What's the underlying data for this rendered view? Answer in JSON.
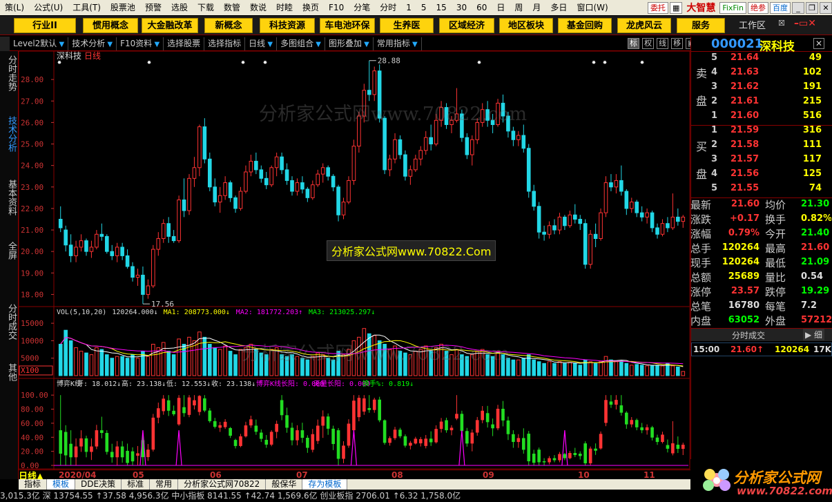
{
  "menu": {
    "items": [
      "策(L)",
      "公式(U)",
      "工具(T)",
      "股票池",
      "预警",
      "选股",
      "下载",
      "数管",
      "数说",
      "时睦",
      "换页",
      "F10",
      "分笔",
      "分时",
      "1",
      "5",
      "15",
      "30",
      "60",
      "日",
      "周",
      "月",
      "多日",
      "窗口(W)"
    ],
    "entrust": "委托",
    "brand": "大智慧",
    "fixfin": "FixFin",
    "judge": "绝参",
    "baidu": "百度"
  },
  "sectors": [
    "行业II",
    "惯用概念",
    "大金融改革",
    "新概念",
    "科技资源",
    "车电池环保",
    "生养医",
    "区域经济",
    "地区板块",
    "基金回购",
    "龙虎风云",
    "服务"
  ],
  "workzone": "工作区",
  "toolbar": {
    "items": [
      "Level2默认",
      "技术分析",
      "F10资料",
      "选择股票",
      "选择指标",
      "日线",
      "多图组合",
      "图形叠加",
      "常用指标"
    ],
    "right": [
      "标",
      "权",
      "线",
      "移"
    ]
  },
  "left_tabs": [
    "分时走势",
    "技术分析",
    "基本资料",
    "全屏",
    "分时成交",
    "其他"
  ],
  "stock": {
    "code": "000021",
    "name": "深科技",
    "chart_title": "深科技",
    "chart_period": "日线"
  },
  "order_book": {
    "sell_label": [
      "卖",
      "盘"
    ],
    "buy_label": [
      "买",
      "盘"
    ],
    "sell": [
      {
        "level": "5",
        "price": "21.64",
        "vol": "49"
      },
      {
        "level": "4",
        "price": "21.63",
        "vol": "102"
      },
      {
        "level": "3",
        "price": "21.62",
        "vol": "191"
      },
      {
        "level": "2",
        "price": "21.61",
        "vol": "215"
      },
      {
        "level": "1",
        "price": "21.60",
        "vol": "516"
      }
    ],
    "buy": [
      {
        "level": "1",
        "price": "21.59",
        "vol": "316"
      },
      {
        "level": "2",
        "price": "21.58",
        "vol": "111"
      },
      {
        "level": "3",
        "price": "21.57",
        "vol": "117"
      },
      {
        "level": "4",
        "price": "21.56",
        "vol": "125"
      },
      {
        "level": "5",
        "price": "21.55",
        "vol": "74"
      }
    ]
  },
  "stats": [
    {
      "k1": "最新",
      "v1": "21.60",
      "c1": "red",
      "k2": "均价",
      "v2": "21.30",
      "c2": "grn"
    },
    {
      "k1": "涨跌",
      "v1": "+0.17",
      "c1": "red",
      "k2": "换手",
      "v2": "0.82%",
      "c2": "yel"
    },
    {
      "k1": "涨幅",
      "v1": "0.79%",
      "c1": "red",
      "k2": "今开",
      "v2": "21.40",
      "c2": "grn"
    },
    {
      "k1": "总手",
      "v1": "120264",
      "c1": "yel",
      "k2": "最高",
      "v2": "21.60",
      "c2": "red"
    },
    {
      "k1": "现手",
      "v1": "120264",
      "c1": "yel",
      "k2": "最低",
      "v2": "21.09",
      "c2": "grn"
    },
    {
      "k1": "总额",
      "v1": "25689",
      "c1": "yel",
      "k2": "量比",
      "v2": "0.54",
      "c2": "wht"
    },
    {
      "k1": "涨停",
      "v1": "23.57",
      "c1": "red",
      "k2": "跌停",
      "v2": "19.29",
      "c2": "grn"
    },
    {
      "k1": "总笔",
      "v1": "16780",
      "c1": "wht",
      "k2": "每笔",
      "v2": "7.2",
      "c2": "wht"
    },
    {
      "k1": "内盘",
      "v1": "63052",
      "c1": "grn",
      "k2": "外盘",
      "v2": "57212",
      "c2": "red"
    }
  ],
  "fs": {
    "label": "分时成交",
    "more": "细",
    "time": "15:00",
    "price": "21.60↑",
    "vol": "120264",
    "extra": "17K"
  },
  "vol_legend": {
    "name": "VOL(5,10,20)",
    "vol": "120264.000↓",
    "ma1": "MA1: 208773.000↓",
    "ma2": "MA2: 181772.203↑",
    "ma3": "MA3: 213025.297↓"
  },
  "ind_legend": {
    "name": "博弈K线",
    "open": "开: 18.012↓",
    "high": "高: 23.138↓",
    "low": "低: 12.553↓",
    "close": "收: 23.138↓",
    "long": "博弈K线长阳: 0.000",
    "noyang": "无量长阳: 0.000",
    "turnover": "换手%: 0.819↓"
  },
  "annotations": {
    "high": "28.88",
    "low": "17.56",
    "vol_mult": "X100"
  },
  "bottom_axis": {
    "labels": [
      "2020/04",
      "05",
      "06",
      "07",
      "08",
      "09",
      "10",
      "11"
    ],
    "period": "日线"
  },
  "bottom_tabs": [
    "指标",
    "模板",
    "DDE决策",
    "标准",
    "常用",
    "分析家公式网70822",
    "般保华",
    "存为模板"
  ],
  "ticker": "3,015.3亿  深 13754.55  ↑37.58  4,956.3亿  中小指板 8141.55  ↑42.74  1,569.6亿  创业板指 2706.01  ↑6.32  1,758.0亿",
  "watermarks": [
    "分析家公式网www.70822.com",
    "分析家公式网www.70822.com"
  ],
  "wm_box": "分析家公式网www.70822.Com",
  "footer": {
    "logo": "分析家公式网",
    "url": "www.70822.com"
  },
  "chart_data": [
    {
      "type": "candlestick",
      "title": "深科技 日线",
      "ylim": [
        17.5,
        29
      ],
      "yticks": [
        "18.00",
        "19.00",
        "20.00",
        "21.00",
        "22.00",
        "23.00",
        "24.00",
        "25.00",
        "26.00",
        "27.00",
        "28.00"
      ],
      "ohlc": [
        [
          21.5,
          22.1,
          20.9,
          21.1
        ],
        [
          21.0,
          21.2,
          20.0,
          20.3
        ],
        [
          20.3,
          20.8,
          19.5,
          19.8
        ],
        [
          19.8,
          20.5,
          19.5,
          20.2
        ],
        [
          20.2,
          20.8,
          20.0,
          20.5
        ],
        [
          20.5,
          20.6,
          19.8,
          20.0
        ],
        [
          20.0,
          20.5,
          19.7,
          20.2
        ],
        [
          20.2,
          21.0,
          20.1,
          20.8
        ],
        [
          20.8,
          21.3,
          20.5,
          20.7
        ],
        [
          20.7,
          20.8,
          19.9,
          20.0
        ],
        [
          20.0,
          20.3,
          19.6,
          19.8
        ],
        [
          19.8,
          20.4,
          19.5,
          20.2
        ],
        [
          20.2,
          20.4,
          19.6,
          19.8
        ],
        [
          19.8,
          20.1,
          19.2,
          19.3
        ],
        [
          19.3,
          19.5,
          18.6,
          18.8
        ],
        [
          18.8,
          19.2,
          18.4,
          18.9
        ],
        [
          18.9,
          19.3,
          17.56,
          18.0
        ],
        [
          18.0,
          18.7,
          17.8,
          18.4
        ],
        [
          18.4,
          20.3,
          18.3,
          20.1
        ],
        [
          20.1,
          20.9,
          19.8,
          20.6
        ],
        [
          20.6,
          21.5,
          20.4,
          21.3
        ],
        [
          21.3,
          21.6,
          20.4,
          20.7
        ],
        [
          20.7,
          21.0,
          20.4,
          20.5
        ],
        [
          20.5,
          22.6,
          20.4,
          22.4
        ],
        [
          22.4,
          23.4,
          21.6,
          21.9
        ],
        [
          21.9,
          23.6,
          21.7,
          23.4
        ],
        [
          23.4,
          24.4,
          23.0,
          23.9
        ],
        [
          23.9,
          25.9,
          23.5,
          25.8
        ],
        [
          25.8,
          26.2,
          24.1,
          24.3
        ],
        [
          24.3,
          24.6,
          22.8,
          23.0
        ],
        [
          23.0,
          23.4,
          22.1,
          22.3
        ],
        [
          22.3,
          23.0,
          21.8,
          22.6
        ],
        [
          22.6,
          23.5,
          22.4,
          23.2
        ],
        [
          23.2,
          23.3,
          22.3,
          22.5
        ],
        [
          22.5,
          22.6,
          21.8,
          22.0
        ],
        [
          22.0,
          23.0,
          21.9,
          22.8
        ],
        [
          22.8,
          24.0,
          22.7,
          23.7
        ],
        [
          23.7,
          24.5,
          23.5,
          24.2
        ],
        [
          24.2,
          24.6,
          23.6,
          23.8
        ],
        [
          23.8,
          24.0,
          23.2,
          23.4
        ],
        [
          23.4,
          23.7,
          22.9,
          23.1
        ],
        [
          23.1,
          24.0,
          23.0,
          23.9
        ],
        [
          23.9,
          24.6,
          23.5,
          24.4
        ],
        [
          24.4,
          24.6,
          23.6,
          23.8
        ],
        [
          23.8,
          24.1,
          23.1,
          23.3
        ],
        [
          23.3,
          23.5,
          22.6,
          22.8
        ],
        [
          22.8,
          23.4,
          22.6,
          23.2
        ],
        [
          23.2,
          23.5,
          22.7,
          22.9
        ],
        [
          22.9,
          23.0,
          22.3,
          22.5
        ],
        [
          22.5,
          23.3,
          22.4,
          23.1
        ],
        [
          23.1,
          23.8,
          23.0,
          23.6
        ],
        [
          23.6,
          24.1,
          23.2,
          23.9
        ],
        [
          23.9,
          24.0,
          23.3,
          23.5
        ],
        [
          23.5,
          23.6,
          22.8,
          23.0
        ],
        [
          23.0,
          23.1,
          21.4,
          21.7
        ],
        [
          21.7,
          22.5,
          21.5,
          22.3
        ],
        [
          22.3,
          23.5,
          22.2,
          23.3
        ],
        [
          23.3,
          25.2,
          23.1,
          24.9
        ],
        [
          24.9,
          26.5,
          24.6,
          26.3
        ],
        [
          26.3,
          27.8,
          26.0,
          27.5
        ],
        [
          27.5,
          28.88,
          27.0,
          27.3
        ],
        [
          27.3,
          28.6,
          27.0,
          28.4
        ],
        [
          28.4,
          28.7,
          26.0,
          26.2
        ],
        [
          26.2,
          26.3,
          23.6,
          23.8
        ],
        [
          23.8,
          24.5,
          23.5,
          24.3
        ],
        [
          24.3,
          25.5,
          24.1,
          25.2
        ],
        [
          25.2,
          25.4,
          24.3,
          24.5
        ],
        [
          24.5,
          24.7,
          23.3,
          23.5
        ],
        [
          23.5,
          24.0,
          23.1,
          23.8
        ],
        [
          23.8,
          24.5,
          23.7,
          24.3
        ],
        [
          24.3,
          24.9,
          24.0,
          24.7
        ],
        [
          24.7,
          25.6,
          24.5,
          25.3
        ],
        [
          25.3,
          25.9,
          24.7,
          25.0
        ],
        [
          25.0,
          26.4,
          24.9,
          26.1
        ],
        [
          26.1,
          27.0,
          25.8,
          26.7
        ],
        [
          26.7,
          26.9,
          25.7,
          25.9
        ],
        [
          25.9,
          26.3,
          25.5,
          26.1
        ],
        [
          26.1,
          27.6,
          26.0,
          26.4
        ],
        [
          26.4,
          26.6,
          25.1,
          25.3
        ],
        [
          25.3,
          25.5,
          24.3,
          24.5
        ],
        [
          24.5,
          25.4,
          24.0,
          25.2
        ],
        [
          25.2,
          26.2,
          25.0,
          26.0
        ],
        [
          26.0,
          26.9,
          25.8,
          26.6
        ],
        [
          26.6,
          27.0,
          25.8,
          26.1
        ],
        [
          26.1,
          26.4,
          25.5,
          25.9
        ],
        [
          25.9,
          27.1,
          25.8,
          26.9
        ],
        [
          26.9,
          27.3,
          26.0,
          26.3
        ],
        [
          26.3,
          26.5,
          25.3,
          25.6
        ],
        [
          25.6,
          25.8,
          24.9,
          25.2
        ],
        [
          25.2,
          25.6,
          24.9,
          25.4
        ],
        [
          25.4,
          25.9,
          24.6,
          24.8
        ],
        [
          24.8,
          25.0,
          22.5,
          22.8
        ],
        [
          22.8,
          23.1,
          21.9,
          22.1
        ],
        [
          22.1,
          22.3,
          20.6,
          20.9
        ],
        [
          20.9,
          21.2,
          20.5,
          20.8
        ],
        [
          20.8,
          21.4,
          20.6,
          21.2
        ],
        [
          21.2,
          21.5,
          20.8,
          21.0
        ],
        [
          21.0,
          21.8,
          20.8,
          21.6
        ],
        [
          21.6,
          21.7,
          21.0,
          21.2
        ],
        [
          21.2,
          21.9,
          21.1,
          21.7
        ],
        [
          21.7,
          22.2,
          21.3,
          21.5
        ],
        [
          21.5,
          21.7,
          21.0,
          21.3
        ],
        [
          21.3,
          21.5,
          19.2,
          19.4
        ],
        [
          19.4,
          21.0,
          19.2,
          20.8
        ],
        [
          20.8,
          21.3,
          20.2,
          20.6
        ],
        [
          20.6,
          22.0,
          20.5,
          21.8
        ],
        [
          21.8,
          23.5,
          21.6,
          23.2
        ],
        [
          23.2,
          23.6,
          22.8,
          23.0
        ],
        [
          23.0,
          23.6,
          22.7,
          23.3
        ],
        [
          23.3,
          24.0,
          22.6,
          22.8
        ],
        [
          22.8,
          22.9,
          21.7,
          22.0
        ],
        [
          22.0,
          22.5,
          21.8,
          22.3
        ],
        [
          22.3,
          22.4,
          21.6,
          21.8
        ],
        [
          21.8,
          22.1,
          21.4,
          21.6
        ],
        [
          21.6,
          22.0,
          21.3,
          21.8
        ],
        [
          21.8,
          21.9,
          20.9,
          21.1
        ],
        [
          21.1,
          21.3,
          20.6,
          20.8
        ],
        [
          20.8,
          21.5,
          20.7,
          21.3
        ],
        [
          21.3,
          21.6,
          20.9,
          21.1
        ],
        [
          21.1,
          22.7,
          21.0,
          21.6
        ],
        [
          21.6,
          22.0,
          21.2,
          21.4
        ],
        [
          21.4,
          21.7,
          21.1,
          21.6
        ]
      ]
    },
    {
      "type": "bar",
      "title": "VOL(5,10,20)",
      "ylim": [
        0,
        17000
      ],
      "yticks": [
        "5000",
        "10000",
        "15000"
      ],
      "values": [
        9000,
        13000,
        10000,
        8000,
        7000,
        6500,
        6000,
        8000,
        7500,
        6000,
        5000,
        5500,
        5500,
        5000,
        6000,
        5000,
        7000,
        5500,
        9000,
        8000,
        9500,
        7000,
        6000,
        10500,
        9000,
        11000,
        10000,
        12500,
        11000,
        9000,
        8000,
        7500,
        8500,
        7000,
        6000,
        7500,
        8000,
        9000,
        7500,
        6500,
        6000,
        7500,
        8000,
        6000,
        5500,
        6000,
        5500,
        5000,
        4500,
        5500,
        6500,
        6000,
        5000,
        4500,
        7000,
        6000,
        7500,
        10000,
        11000,
        13500,
        12000,
        11500,
        10000,
        9000,
        7500,
        8500,
        7000,
        6500,
        6000,
        7000,
        7500,
        8500,
        7000,
        8000,
        9000,
        7000,
        6000,
        7500,
        6000,
        5500,
        6000,
        7000,
        7500,
        6000,
        5500,
        7000,
        6000,
        5000,
        4500,
        4500,
        5000,
        6000,
        4500,
        4000,
        3500,
        4000,
        3500,
        4000,
        3500,
        3800,
        3500,
        3000,
        4500,
        4000,
        3500,
        4000,
        5500,
        4500,
        4000,
        4200,
        3500,
        3000,
        3200,
        3000,
        2800,
        2800,
        3000,
        2800,
        3500,
        2800,
        2500,
        1200
      ],
      "series": [
        {
          "name": "MA1",
          "values_from": "5-period moving average"
        }
      ]
    },
    {
      "type": "bar",
      "title": "博弈K线",
      "ylim": [
        0,
        110
      ],
      "yticks": [
        "0.00",
        "20.00",
        "40.00",
        "60.00",
        "80.00",
        "100.00"
      ]
    }
  ]
}
